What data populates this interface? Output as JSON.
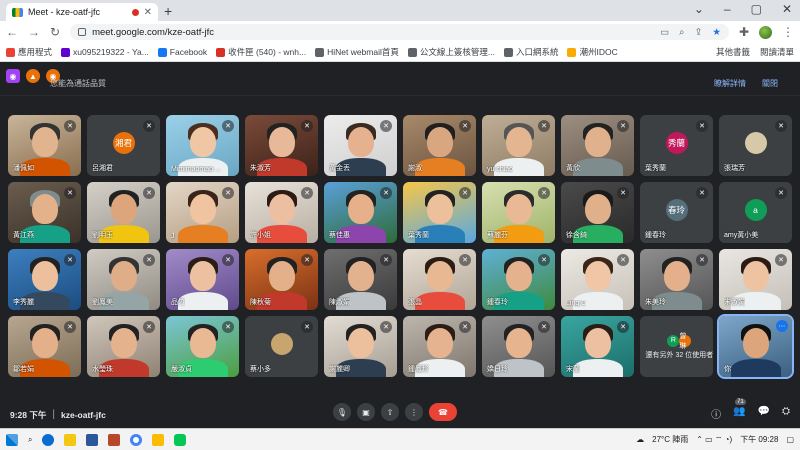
{
  "browser": {
    "tab_title": "Meet - kze-oatf-jfc",
    "url": "meet.google.com/kze-oatf-jfc",
    "bookmarks": [
      {
        "label": "應用程式",
        "color": "#ea4335"
      },
      {
        "label": "xu095219322 - Ya...",
        "color": "#6001d2"
      },
      {
        "label": "Facebook",
        "color": "#1877f2"
      },
      {
        "label": "收件匣 (540) - wnh...",
        "color": "#d93025"
      },
      {
        "label": "HiNet webmail首頁",
        "color": "#5f6368"
      },
      {
        "label": "公文線上簽核管理...",
        "color": "#5f6368"
      },
      {
        "label": "入口網系統",
        "color": "#5f6368"
      },
      {
        "label": "潮州IDOC",
        "color": "#f9ab00"
      }
    ],
    "bookmarks_right": [
      "其他書籤",
      "閱讀清單"
    ]
  },
  "banner": {
    "message": "您能為通話品質",
    "links": [
      "瞭解詳情",
      "關閉"
    ]
  },
  "participants": [
    {
      "name": "潘佩如",
      "type": "video",
      "bg1": "#c8b59a",
      "bg2": "#8a6d4f",
      "skin": "#e0b48f",
      "hair": "#333",
      "shirt": "#d35400"
    },
    {
      "name": "呂湘君",
      "type": "initial",
      "initial": "湘君",
      "color": "#e8710a"
    },
    {
      "name": "Mimimaomao ...",
      "type": "video",
      "bg1": "#9bd0e8",
      "bg2": "#6aa7c4",
      "skin": "#f0c7a4",
      "hair": "#4a2e20",
      "shirt": "#ecf0f1"
    },
    {
      "name": "朱淑芳",
      "type": "video",
      "bg1": "#7a4b3a",
      "bg2": "#3d2219",
      "skin": "#e7b999",
      "hair": "#222",
      "shirt": "#c0392b"
    },
    {
      "name": "黃金丟",
      "type": "video",
      "bg1": "#ececec",
      "bg2": "#cfcfcf",
      "skin": "#e5b18e",
      "hair": "#3b2a20",
      "shirt": "#2c3e50"
    },
    {
      "name": "謝淑",
      "type": "video",
      "bg1": "#a88a6a",
      "bg2": "#6c5440",
      "skin": "#d9a77f",
      "hair": "#1f1f1f",
      "shirt": "#e67e22"
    },
    {
      "name": "yu chiao",
      "type": "video",
      "bg1": "#bfae96",
      "bg2": "#8f7b63",
      "skin": "#e3b591",
      "hair": "#555",
      "shirt": "#ecf0f1"
    },
    {
      "name": "黃欣",
      "type": "video",
      "bg1": "#9c8f82",
      "bg2": "#675a4e",
      "skin": "#e0b18d",
      "hair": "#222",
      "shirt": "#7f8c8d"
    },
    {
      "name": "葉秀蘭",
      "type": "initial",
      "initial": "秀蘭",
      "color": "#c2185b"
    },
    {
      "name": "張瑞芳",
      "type": "avatar",
      "color": "#d6c9a8"
    },
    {
      "name": "黃江燕",
      "type": "video",
      "bg1": "#6b5d4f",
      "bg2": "#3a3129",
      "skin": "#e3b18a",
      "hair": "#7f8c8d",
      "shirt": "#16a085"
    },
    {
      "name": "劉明玉",
      "type": "video",
      "bg1": "#d5d0c8",
      "bg2": "#9a958d",
      "skin": "#dca57c",
      "hair": "#222",
      "shirt": "#f1c40f"
    },
    {
      "name": "J",
      "type": "video",
      "bg1": "#e3d6c6",
      "bg2": "#b59e83",
      "skin": "#f0c4a0",
      "hair": "#3a241a",
      "shirt": "#e67e22"
    },
    {
      "name": "許小姐",
      "type": "video",
      "bg1": "#e8e2da",
      "bg2": "#b8aea2",
      "skin": "#ecbfa0",
      "hair": "#2b1b14",
      "shirt": "#e74c3c"
    },
    {
      "name": "蔡佳惠",
      "type": "video",
      "bg1": "#5aa0d8",
      "bg2": "#2e6b3a",
      "skin": "#e5b08a",
      "hair": "#222",
      "shirt": "#8e44ad"
    },
    {
      "name": "葉秀蘭",
      "type": "video",
      "bg1": "#f6c64a",
      "bg2": "#58a8e0",
      "skin": "#ecc09b",
      "hair": "#222",
      "shirt": "#2980b9"
    },
    {
      "name": "蘇麗芬",
      "type": "video",
      "bg1": "#d7dfb0",
      "bg2": "#9fb46a",
      "skin": "#e8b994",
      "hair": "#2b2b2b",
      "shirt": "#f39c12"
    },
    {
      "name": "徐含錡",
      "type": "video",
      "bg1": "#4a4a4a",
      "bg2": "#2a2a2a",
      "skin": "#e0b08b",
      "hair": "#1a1a1a",
      "shirt": "#27ae60"
    },
    {
      "name": "鍾春玲",
      "type": "initial",
      "initial": "春玲",
      "color": "#546e7a"
    },
    {
      "name": "amy黃小美",
      "type": "initial",
      "initial": "a",
      "color": "#0f9d58"
    },
    {
      "name": "李秀麗",
      "type": "video",
      "bg1": "#3d7fbf",
      "bg2": "#1b4d80",
      "skin": "#ecbf9d",
      "hair": "#222",
      "shirt": "#34495e"
    },
    {
      "name": "劉鳳美",
      "type": "video",
      "bg1": "#d0ccc4",
      "bg2": "#8f8a82",
      "skin": "#dfae88",
      "hair": "#333",
      "shirt": "#95a5a6"
    },
    {
      "name": "品竹",
      "type": "video",
      "bg1": "#a38bc9",
      "bg2": "#5f4a8c",
      "skin": "#ecc0a0",
      "hair": "#2a1d16",
      "shirt": "#ecf0f1"
    },
    {
      "name": "陳秋菊",
      "type": "video",
      "bg1": "#d86e2c",
      "bg2": "#7b3214",
      "skin": "#e3b089",
      "hair": "#222",
      "shirt": "#c0392b"
    },
    {
      "name": "陳淑娟",
      "type": "video",
      "bg1": "#6f6f6f",
      "bg2": "#3a3a3a",
      "skin": "#e2b28f",
      "hair": "#222",
      "shirt": "#bdc3c7"
    },
    {
      "name": "張晶",
      "type": "video",
      "bg1": "#e6ddd2",
      "bg2": "#b0a595",
      "skin": "#e8b892",
      "hair": "#2b1c14",
      "shirt": "#e74c3c"
    },
    {
      "name": "鍾春玲",
      "type": "video",
      "bg1": "#5fb0d6",
      "bg2": "#3e8a3e",
      "skin": "#e4b38e",
      "hair": "#222",
      "shirt": "#16a085"
    },
    {
      "name": "Ling C",
      "type": "video",
      "bg1": "#ece9e4",
      "bg2": "#c7c1b8",
      "skin": "#f0c6a6",
      "hair": "#3a2519",
      "shirt": "#ecf0f1"
    },
    {
      "name": "朱美玲",
      "type": "video",
      "bg1": "#8e8e8e",
      "bg2": "#555",
      "skin": "#e4b08b",
      "hair": "#222",
      "shirt": "#7f8c8d"
    },
    {
      "name": "宋淑娟",
      "type": "video",
      "bg1": "#e9e6e1",
      "bg2": "#c4bfb8",
      "skin": "#eec3a2",
      "hair": "#2b1b14",
      "shirt": "#ecf0f1"
    },
    {
      "name": "鄒若娟",
      "type": "video",
      "bg1": "#b7a790",
      "bg2": "#7d6d57",
      "skin": "#e3b08a",
      "hair": "#222",
      "shirt": "#d35400"
    },
    {
      "name": "水瑩珠",
      "type": "video",
      "bg1": "#d0c6ba",
      "bg2": "#8f8275",
      "skin": "#e4b28d",
      "hair": "#222",
      "shirt": "#c0392b"
    },
    {
      "name": "嚴淑貞",
      "type": "video",
      "bg1": "#7cc6d6",
      "bg2": "#4b9e3f",
      "skin": "#e9b993",
      "hair": "#222",
      "shirt": "#2ecc71"
    },
    {
      "name": "蔡小多",
      "type": "avatar",
      "color": "#c8a46e"
    },
    {
      "name": "謝麗卿",
      "type": "video",
      "bg1": "#e2dcd4",
      "bg2": "#a79e92",
      "skin": "#ecbf9d",
      "hair": "#222",
      "shirt": "#2c3e50"
    },
    {
      "name": "鍾鳳珍",
      "type": "video",
      "bg1": "#bdb6ad",
      "bg2": "#7f776d",
      "skin": "#e5b38f",
      "hair": "#2b1c14",
      "shirt": "#ecf0f1"
    },
    {
      "name": "嬌日玲",
      "type": "video",
      "bg1": "#8f8f8f",
      "bg2": "#555",
      "skin": "#e6b48f",
      "hair": "#222",
      "shirt": "#bdc3c7"
    },
    {
      "name": "宋蘭",
      "type": "video",
      "bg1": "#3aa5a0",
      "bg2": "#1c6e6a",
      "skin": "#ecc0a0",
      "hair": "#2a1d16",
      "shirt": "#ecf0f1"
    },
    {
      "name": "還有另外 32 位使用者",
      "type": "others",
      "avatars": [
        {
          "text": "R",
          "color": "#0f9d58"
        },
        {
          "text": "曾琳",
          "color": "#e8710a"
        }
      ]
    },
    {
      "name": "你",
      "type": "self",
      "bg1": "#7da7c9",
      "bg2": "#3b5f80",
      "skin": "#dca57c",
      "hair": "#111",
      "shirt": "#1f3a5f"
    }
  ],
  "meeting": {
    "time": "9:28 下午",
    "code": "kze-oatf-jfc",
    "participant_count": "71"
  },
  "taskbar": {
    "weather": "27°C 陣雨",
    "clock": "下午 09:28"
  }
}
